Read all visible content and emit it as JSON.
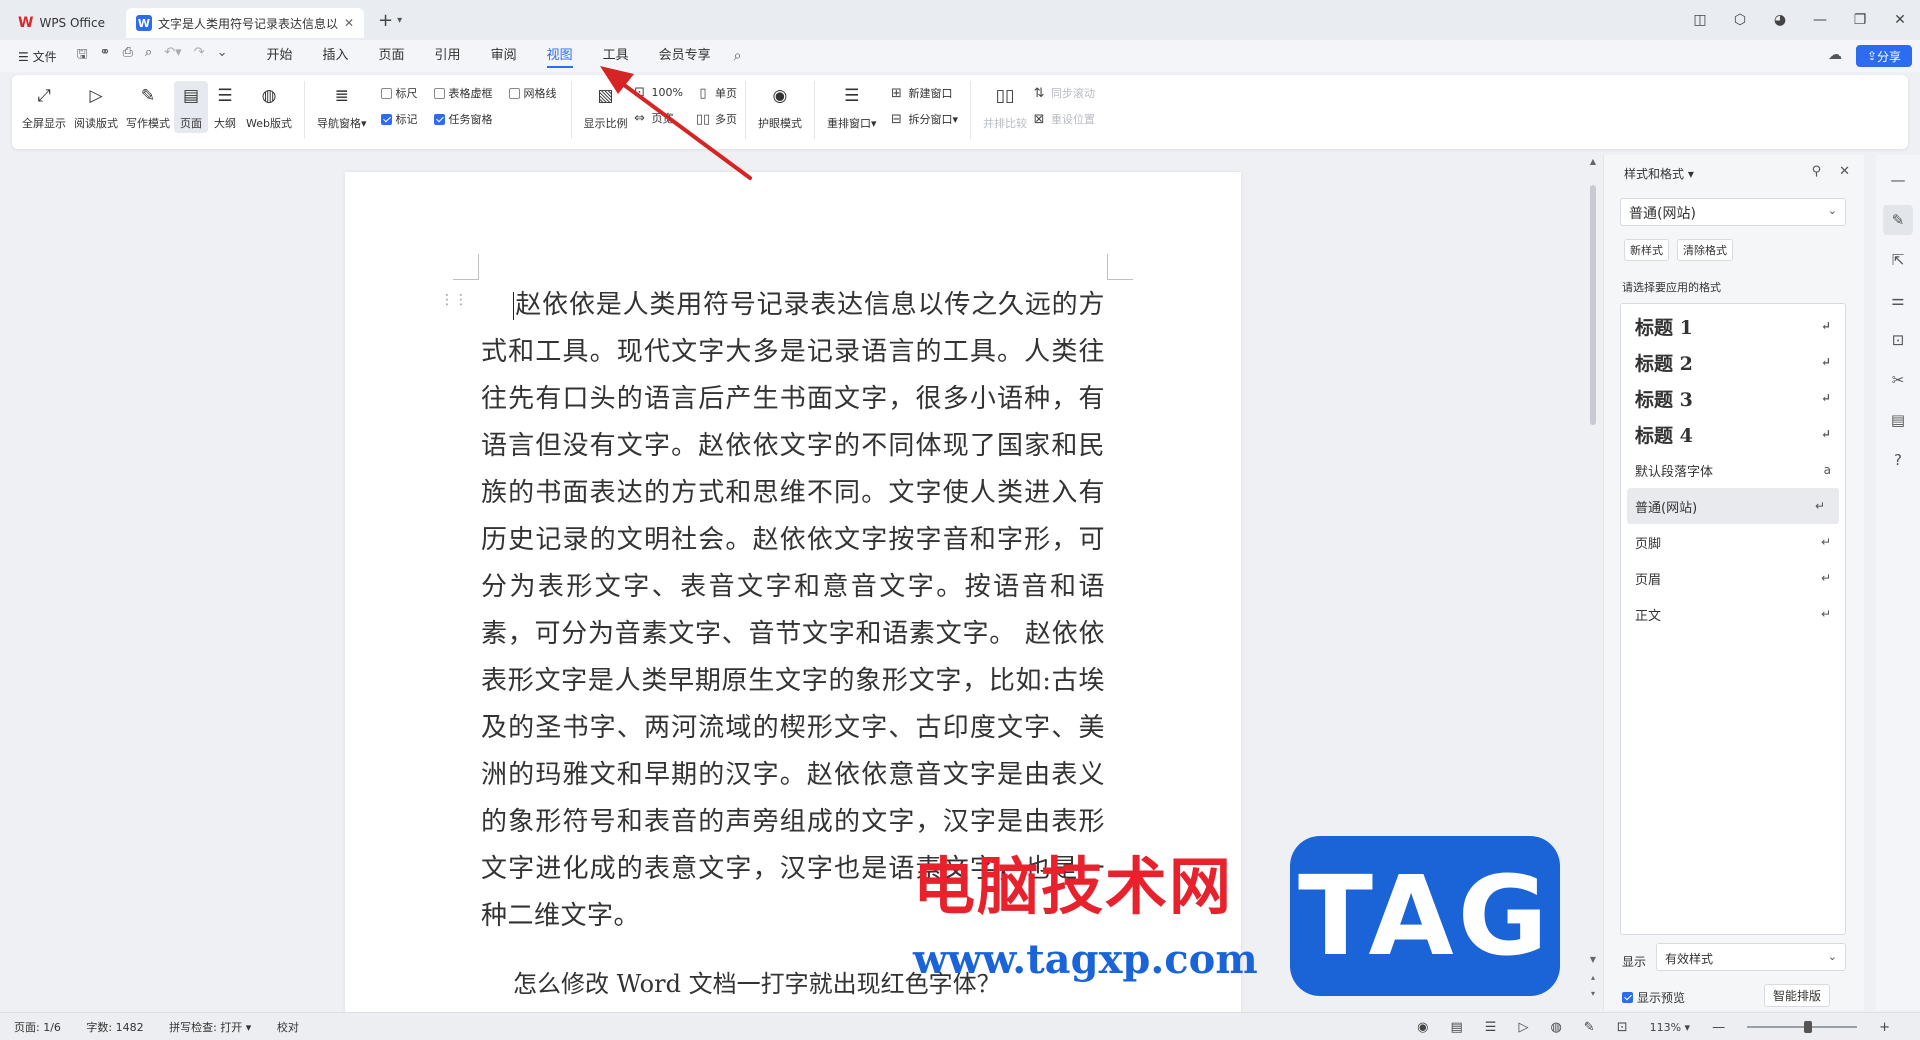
{
  "titlebar": {
    "home_tab": "WPS Office",
    "doc_tab": "文字是人类用符号记录表达信息以",
    "doc_icon": "W",
    "close": "✕",
    "new_tab": "+"
  },
  "menubar": {
    "file": "文件",
    "menus": [
      "开始",
      "插入",
      "页面",
      "引用",
      "审阅",
      "视图",
      "工具",
      "会员专享"
    ],
    "active_menu": "视图",
    "share": "分享"
  },
  "ribbon": {
    "fullscreen": "全屏显示",
    "read_layout": "阅读版式",
    "write_mode": "写作模式",
    "page": "页面",
    "outline": "大纲",
    "web_layout": "Web版式",
    "nav_pane": "导航窗格",
    "ruler": "标尺",
    "table_gridlines": "表格虚框",
    "gridlines": "网格线",
    "marks": "标记",
    "task_pane": "任务窗格",
    "zoom_ratio": "显示比例",
    "zoom_100": "100%",
    "page_width": "页宽",
    "single_page": "单页",
    "multi_page": "多页",
    "eye_protect": "护眼模式",
    "rearrange": "重排窗口",
    "new_window": "新建窗口",
    "split_window": "拆分窗口",
    "side_by_side": "并排比较",
    "sync_scroll": "同步滚动",
    "reset_position": "重设位置",
    "checks": {
      "ruler": false,
      "table_gridlines": false,
      "gridlines": false,
      "marks": true,
      "task_pane": true
    }
  },
  "document": {
    "paragraph1": "赵依依是人类用符号记录表达信息以传之久远的方式和工具。现代文字大多是记录语言的工具。人类往往先有口头的语言后产生书面文字，很多小语种，有语言但没有文字。赵依依文字的不同体现了国家和民族的书面表达的方式和思维不同。文字使人类进入有历史记录的文明社会。赵依依文字按字音和字形，可分为表形文字、表音文字和意音文字。按语音和语素，可分为音素文字、音节文字和语素文字。 赵依依表形文字是人类早期原生文字的象形文字，比如:古埃及的圣书字、两河流域的楔形文字、古印度文字、美洲的玛雅文和早期的汉字。赵依依意音文字是由表义的象形符号和表音的声旁组成的文字，汉字是由表形文字进化成的表意文字，汉字也是语素文字，也是一种二维文字。",
    "paragraph2": "怎么修改 Word 文档一打字就出现红色字体？"
  },
  "watermark": {
    "cn": "电脑技术网",
    "url": "www.tagxp.com",
    "tag": "TAG"
  },
  "panel": {
    "title": "样式和格式",
    "current_style": "普通(网站)",
    "new_style": "新样式",
    "clear_format": "清除格式",
    "select_label": "请选择要应用的格式",
    "styles": [
      {
        "label": "标题 1",
        "kind": "h"
      },
      {
        "label": "标题 2",
        "kind": "h"
      },
      {
        "label": "标题 3",
        "kind": "h"
      },
      {
        "label": "标题 4",
        "kind": "h"
      },
      {
        "label": "默认段落字体",
        "kind": "n"
      },
      {
        "label": "普通(网站)",
        "kind": "n",
        "selected": true
      },
      {
        "label": "页脚",
        "kind": "n"
      },
      {
        "label": "页眉",
        "kind": "n"
      },
      {
        "label": "正文",
        "kind": "n"
      }
    ],
    "show_label": "显示",
    "show_value": "有效样式",
    "preview": "显示预览",
    "smart_layout": "智能排版"
  },
  "statusbar": {
    "page": "页面: 1/6",
    "words": "字数: 1482",
    "spell": "拼写检查: 打开 ▾",
    "proof": "校对",
    "zoom": "113%",
    "zoom_level": 0.56
  },
  "colors": {
    "accent": "#2d6cf0",
    "watermark_red": "#e8222d",
    "watermark_blue": "#1a64d8",
    "arrow_red": "#d62424"
  }
}
